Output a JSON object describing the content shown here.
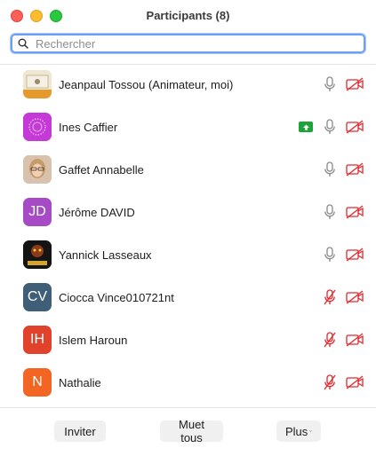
{
  "window": {
    "title": "Participants (8)"
  },
  "search": {
    "placeholder": "Rechercher",
    "value": ""
  },
  "participants": [
    {
      "name": "Jeanpaul Tossou (Animateur, moi)",
      "initials": "",
      "avatar_color": "#d9a441",
      "mic": "on",
      "video": "off",
      "sharing": false
    },
    {
      "name": "Ines Caffier",
      "initials": "",
      "avatar_color": "#c53ad6",
      "mic": "on",
      "video": "off",
      "sharing": true
    },
    {
      "name": "Gaffet Annabelle",
      "initials": "",
      "avatar_color": "#b08a6e",
      "mic": "on",
      "video": "off",
      "sharing": false
    },
    {
      "name": "Jérôme DAVID",
      "initials": "JD",
      "avatar_color": "#a64bc5",
      "mic": "on",
      "video": "off",
      "sharing": false
    },
    {
      "name": "Yannick Lasseaux",
      "initials": "",
      "avatar_color": "#141414",
      "mic": "on",
      "video": "off",
      "sharing": false
    },
    {
      "name": "Ciocca Vince010721nt",
      "initials": "CV",
      "avatar_color": "#3f5e78",
      "mic": "off",
      "video": "off",
      "sharing": false
    },
    {
      "name": "Islem Haroun",
      "initials": "IH",
      "avatar_color": "#e0422b",
      "mic": "off",
      "video": "off",
      "sharing": false
    },
    {
      "name": "Nathalie",
      "initials": "N",
      "avatar_color": "#f26522",
      "mic": "off",
      "video": "off",
      "sharing": false
    }
  ],
  "footer": {
    "invite_label": "Inviter",
    "mute_all_label": "Muet tous",
    "more_label": "Plus"
  },
  "colors": {
    "muted_red": "#e0272c",
    "icon_gray": "#8a8a8e",
    "share_green": "#1ea23a",
    "focus_blue": "#6c9ef8"
  }
}
